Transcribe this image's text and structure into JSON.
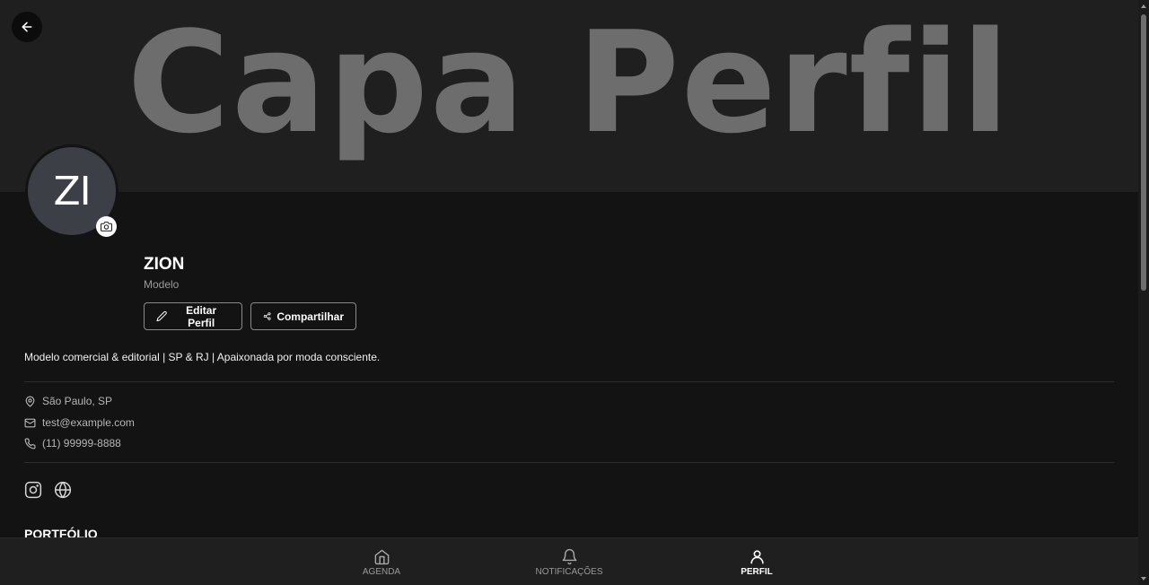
{
  "cover": {
    "text": "Capa Perfil"
  },
  "profile": {
    "initials": "ZI",
    "name": "ZION",
    "role": "Modelo",
    "bio": "Modelo comercial & editorial | SP & RJ | Apaixonada por moda consciente."
  },
  "actions": {
    "edit_label": "Editar Perfil",
    "share_label": "Compartilhar"
  },
  "contact": {
    "location": "São Paulo, SP",
    "email": "test@example.com",
    "phone": "(11) 99999-8888"
  },
  "social": [
    "instagram-icon",
    "globe-icon"
  ],
  "portfolio": {
    "title": "PORTFÓLIO"
  },
  "nav": {
    "items": [
      {
        "label": "AGENDA",
        "icon": "home-icon",
        "active": false
      },
      {
        "label": "NOTIFICAÇÕES",
        "icon": "bell-icon",
        "active": false
      },
      {
        "label": "PERFIL",
        "icon": "user-icon",
        "active": true
      }
    ]
  },
  "colors": {
    "background": "#131314",
    "cover": "#1f1f20",
    "avatar": "#3c3f46",
    "cover_text": "#6d6d6e"
  }
}
